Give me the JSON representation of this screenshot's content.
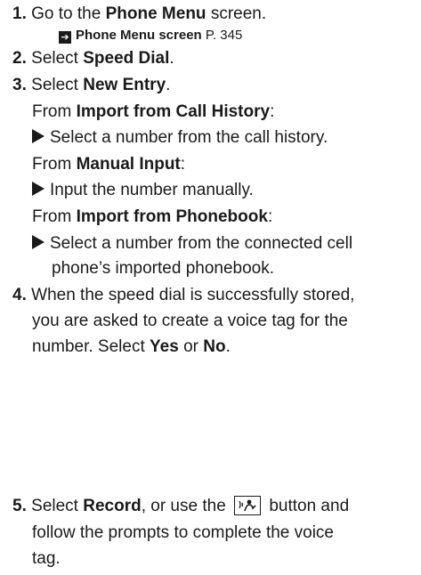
{
  "steps": {
    "s1": {
      "num": "1.",
      "pre": "Go to the ",
      "bold": "Phone Menu",
      "post": " screen."
    },
    "ref": {
      "bold": "Phone Menu screen",
      "post": " P. 345"
    },
    "s2": {
      "num": "2.",
      "pre": "Select ",
      "bold": "Speed Dial",
      "post": "."
    },
    "s3": {
      "num": "3.",
      "pre": "Select ",
      "bold": "New Entry",
      "post": "."
    },
    "from1": {
      "pre": "From ",
      "bold": "Import from Call History",
      "post": ":"
    },
    "sub1": "Select a number from the call history.",
    "from2": {
      "pre": "From ",
      "bold": "Manual Input",
      "post": ":"
    },
    "sub2": "Input the number manually.",
    "from3": {
      "pre": "From ",
      "bold": "Import from Phonebook",
      "post": ":"
    },
    "sub3a": "Select a number from the connected cell",
    "sub3b": "phone’s imported phonebook.",
    "s4": {
      "num": "4.",
      "l1": "When the speed dial is successfully stored,",
      "l2": "you are asked to create a voice tag for the",
      "l3_pre": "number. Select ",
      "yes": "Yes",
      "or": " or ",
      "no": "No",
      "end": "."
    },
    "s5": {
      "num": "5.",
      "pre": "Select ",
      "bold": "Record",
      "mid": ", or use the ",
      "post": " button and",
      "l2": "follow the prompts to complete the voice",
      "l3": "tag."
    }
  }
}
